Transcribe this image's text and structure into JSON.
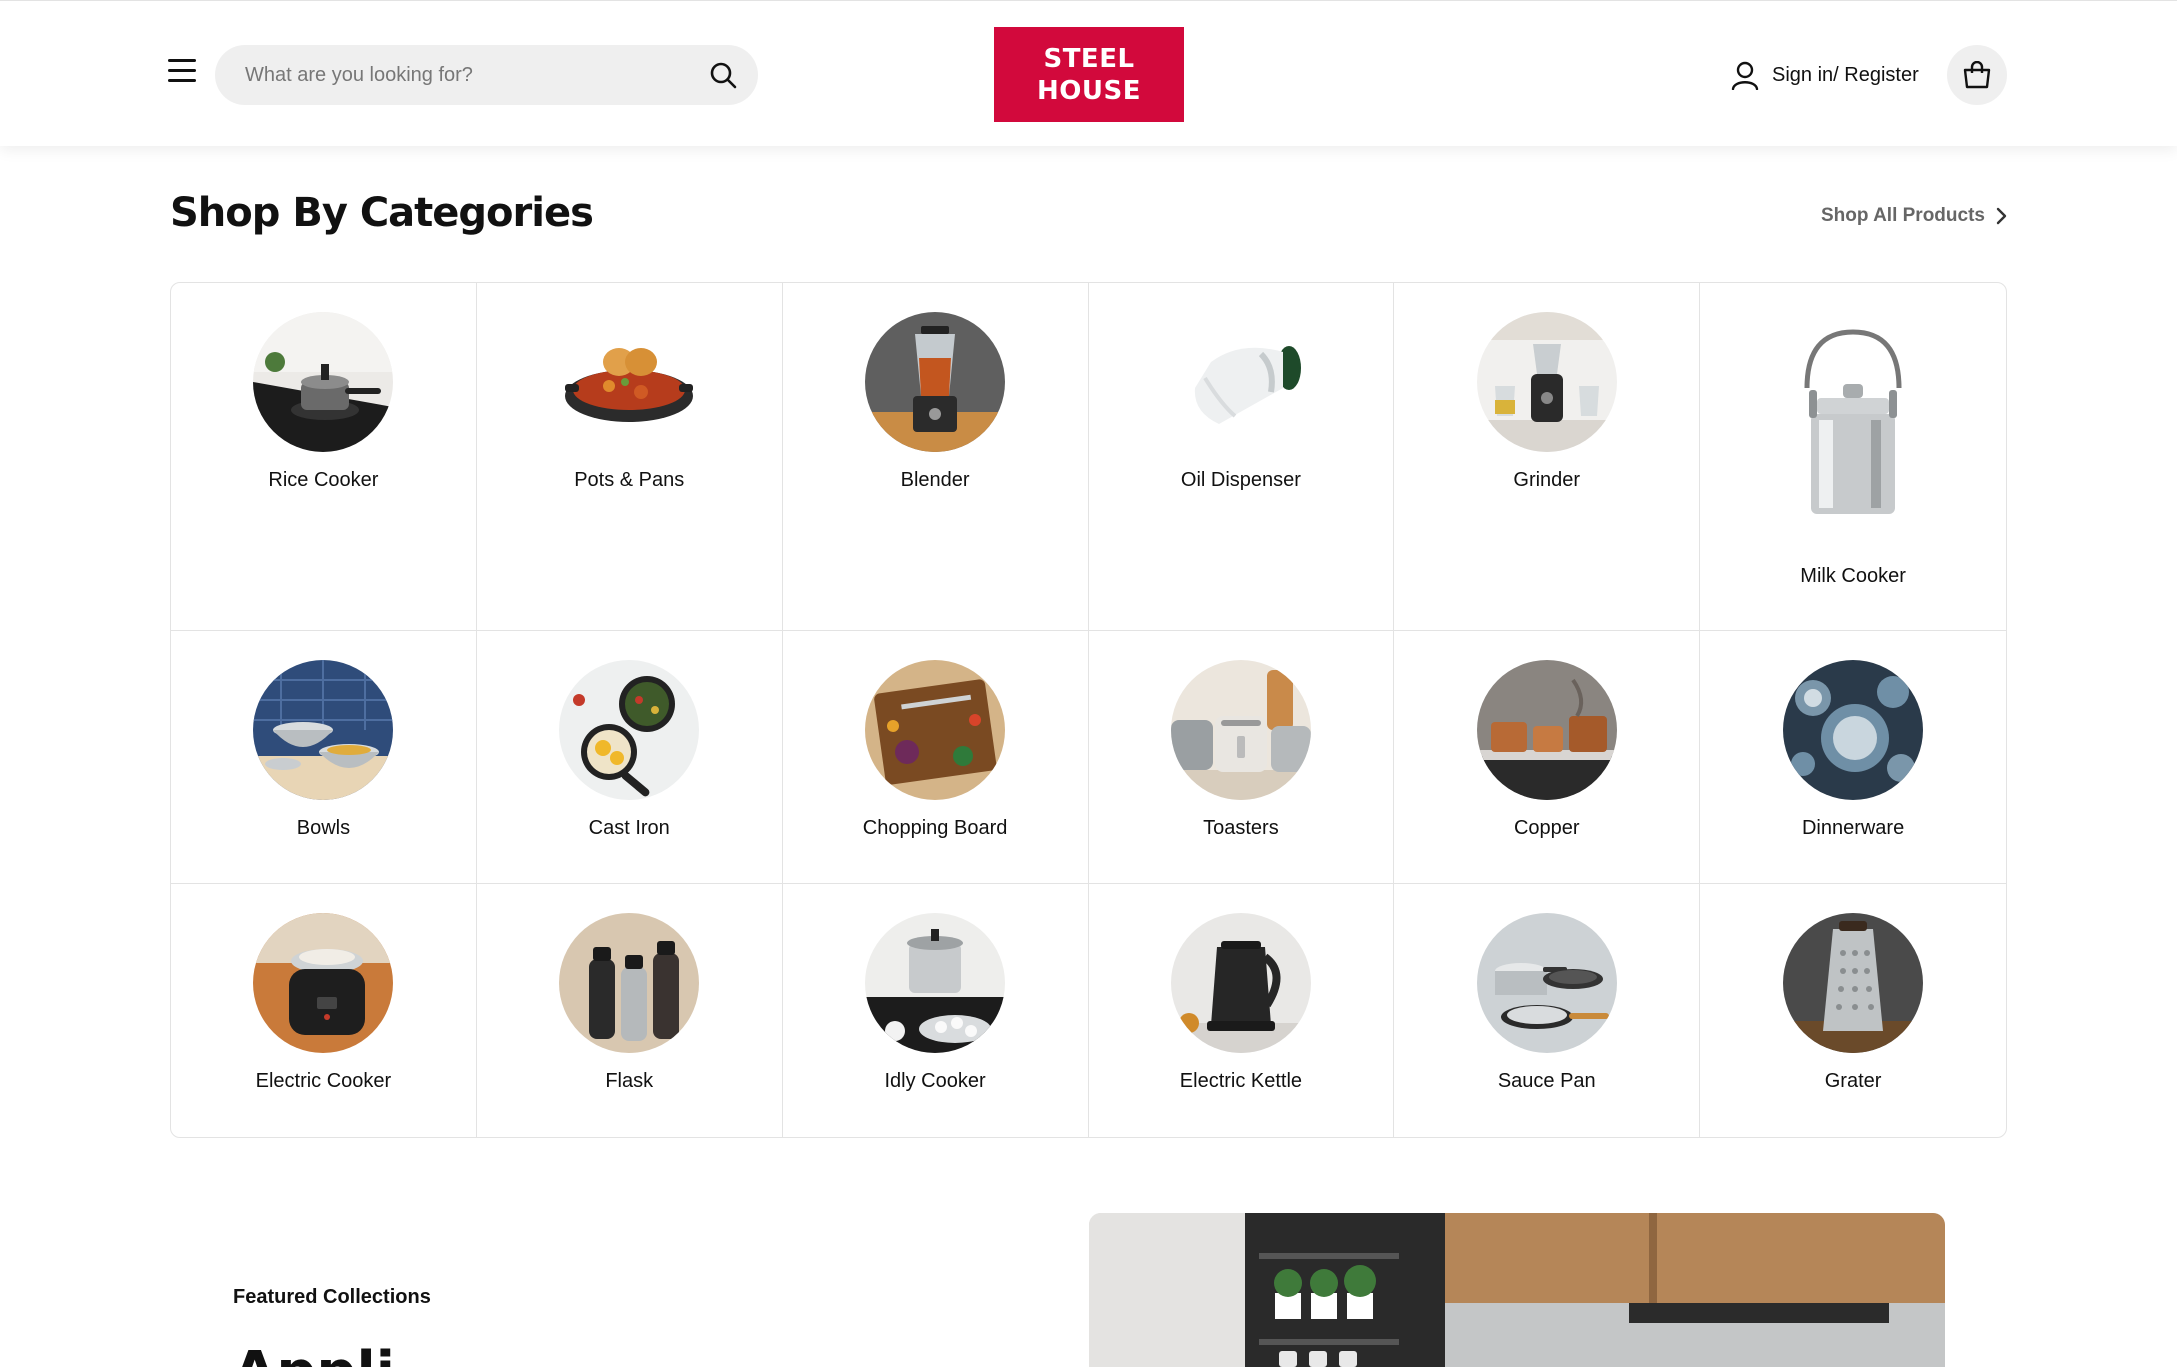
{
  "header": {
    "search_placeholder": "What are you looking for?",
    "logo_line1": "STEEL",
    "logo_line2": "HOUSE",
    "signin_label": "Sign in/ Register"
  },
  "categories_section": {
    "title": "Shop By Categories",
    "shop_all_label": "Shop All Products",
    "items": [
      {
        "label": "Rice Cooker"
      },
      {
        "label": "Pots & Pans"
      },
      {
        "label": "Blender"
      },
      {
        "label": "Oil Dispenser"
      },
      {
        "label": "Grinder"
      },
      {
        "label": "Milk Cooker"
      },
      {
        "label": "Bowls"
      },
      {
        "label": "Cast Iron"
      },
      {
        "label": "Chopping Board"
      },
      {
        "label": "Toasters"
      },
      {
        "label": "Copper"
      },
      {
        "label": "Dinnerware"
      },
      {
        "label": "Electric Cooker"
      },
      {
        "label": "Flask"
      },
      {
        "label": "Idly Cooker"
      },
      {
        "label": "Electric Kettle"
      },
      {
        "label": "Sauce Pan"
      },
      {
        "label": "Grater"
      }
    ]
  },
  "featured": {
    "eyebrow": "Featured Collections",
    "heading": "Appli"
  },
  "colors": {
    "brand": "#d2093c",
    "search_bg": "#efefef",
    "border": "#e3e3e3"
  }
}
